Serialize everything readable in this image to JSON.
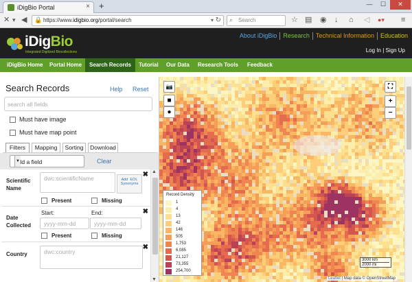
{
  "browser": {
    "tab_title": "iDigBio Portal",
    "url_scheme": "https://www.",
    "url_domain": "idigbio.org",
    "url_path": "/portal/search",
    "search_placeholder": "Search",
    "new_tab_label": "+"
  },
  "header": {
    "logo_text_1": "iDig",
    "logo_text_2": "Bio",
    "logo_tagline": "Integrated Digitized Biocollections",
    "nav": [
      "About iDigBio",
      "Research",
      "Technical Information",
      "Education"
    ],
    "login": "Log In",
    "signup": "Sign Up",
    "login_sep": "|"
  },
  "menu": [
    "iDigBio Home",
    "Portal Home",
    "Search Records",
    "Tutorial",
    "Our Data",
    "Research Tools",
    "Feedback"
  ],
  "menu_active": "Search Records",
  "search": {
    "title": "Search Records",
    "help": "Help",
    "reset": "Reset",
    "all_fields_placeholder": "search all fields",
    "must_have_image": "Must have image",
    "must_have_map_point": "Must have map point",
    "subtabs": [
      "Filters",
      "Mapping",
      "Sorting",
      "Download"
    ],
    "add_field": "Add a field",
    "clear": "Clear",
    "fields": {
      "scientific_name": {
        "label_1": "Scientific",
        "label_2": "Name",
        "placeholder": "dwc:scientificName",
        "eol_1": "Add",
        "eol_2": "EOL",
        "eol_3": "Synonyms",
        "present": "Present",
        "missing": "Missing"
      },
      "date_collected": {
        "label_1": "Date",
        "label_2": "Collected",
        "start": "Start:",
        "end": "End:",
        "start_placeholder": "yyyy-mm-dd",
        "end_placeholder": "yyyy-mm-dd",
        "present": "Present",
        "missing": "Missing"
      },
      "country": {
        "label": "Country",
        "placeholder": "dwc:country"
      }
    }
  },
  "map": {
    "zoom_in": "+",
    "zoom_out": "−",
    "legend_title": "Record Density",
    "legend": [
      {
        "value": "1",
        "color": "#fbf6c4"
      },
      {
        "value": "4",
        "color": "#fbeeac"
      },
      {
        "value": "13",
        "color": "#fce08f"
      },
      {
        "value": "42",
        "color": "#fcce79"
      },
      {
        "value": "146",
        "color": "#f9b764"
      },
      {
        "value": "505",
        "color": "#f59e58"
      },
      {
        "value": "1,753",
        "color": "#ef8551"
      },
      {
        "value": "6,085",
        "color": "#e56b4e"
      },
      {
        "value": "21,127",
        "color": "#d25550"
      },
      {
        "value": "73,355",
        "color": "#b94257"
      },
      {
        "value": "254,700",
        "color": "#9c3360"
      }
    ],
    "scale_km": "3000 km",
    "scale_mi": "2000 mi",
    "attribution_leaflet": "Leaflet",
    "attribution_sep": " | Map data © OpenStreetMap"
  }
}
